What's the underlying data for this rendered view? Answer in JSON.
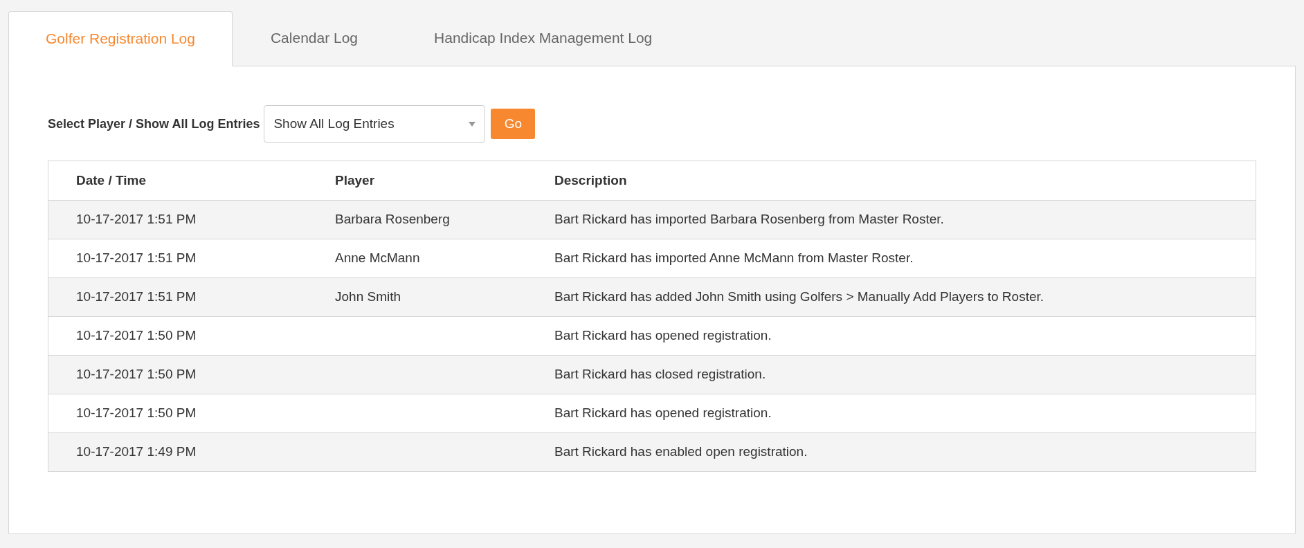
{
  "tabs": [
    {
      "label": "Golfer Registration Log",
      "selected": true
    },
    {
      "label": "Calendar Log",
      "selected": false
    },
    {
      "label": "Handicap Index Management Log",
      "selected": false
    }
  ],
  "filter": {
    "label": "Select Player / Show All Log Entries",
    "select_value": "Show All Log Entries",
    "button": "Go"
  },
  "table": {
    "columns": [
      "Date / Time",
      "Player",
      "Description"
    ],
    "rows": [
      {
        "cells": [
          "10-17-2017 1:51 PM",
          "Barbara Rosenberg",
          "Bart Rickard has imported Barbara Rosenberg from Master Roster."
        ]
      },
      {
        "cells": [
          "10-17-2017 1:51 PM",
          "Anne McMann",
          "Bart Rickard has imported Anne McMann from Master Roster."
        ]
      },
      {
        "cells": [
          "10-17-2017 1:51 PM",
          "John Smith",
          "Bart Rickard has added John Smith using Golfers > Manually Add Players to Roster."
        ]
      },
      {
        "cells": [
          "10-17-2017 1:50 PM",
          "",
          "Bart Rickard has opened registration."
        ]
      },
      {
        "cells": [
          "10-17-2017 1:50 PM",
          "",
          "Bart Rickard has closed registration."
        ]
      },
      {
        "cells": [
          "10-17-2017 1:50 PM",
          "",
          "Bart Rickard has opened registration."
        ]
      },
      {
        "cells": [
          "10-17-2017 1:49 PM",
          "",
          "Bart Rickard has enabled open registration."
        ]
      }
    ]
  }
}
